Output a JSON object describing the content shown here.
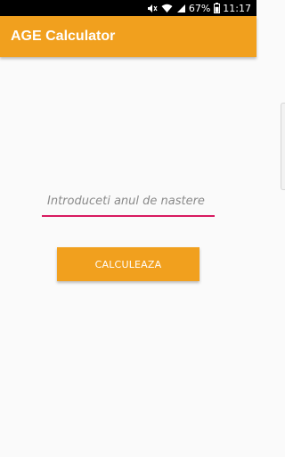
{
  "status_bar": {
    "battery_percent": "67%",
    "time": "11:17",
    "icons": [
      "mute-icon",
      "wifi-icon",
      "signal-icon",
      "battery-icon"
    ]
  },
  "app_bar": {
    "title": "AGE Calculator"
  },
  "form": {
    "year_input_value": "",
    "year_input_placeholder": "Introduceti anul de nastere",
    "calculate_label": "CALCULEAZA"
  },
  "colors": {
    "accent": "#F1A01E",
    "field_line": "#D81B60",
    "background": "#FAFAFA",
    "status_bar": "#000000"
  }
}
